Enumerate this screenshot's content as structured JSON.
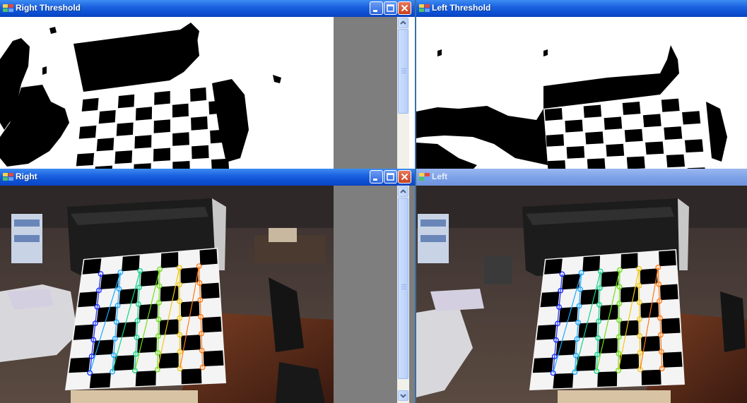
{
  "windows": {
    "right_threshold": {
      "title": "Right Threshold",
      "active": true
    },
    "left_threshold": {
      "title": "Left Threshold",
      "active": true
    },
    "right": {
      "title": "Right",
      "active": true
    },
    "left": {
      "title": "Left",
      "active": false
    }
  },
  "colors": {
    "titlebar_active": "#0c4fd2",
    "titlebar_inactive": "#7ea2e8",
    "close_button": "#c8401c",
    "image_padding": "#7e7e7e"
  },
  "icons": {
    "app": "opencv-window-icon",
    "minimize": "minimize-icon",
    "maximize": "maximize-icon",
    "close": "close-icon",
    "scroll_up": "scroll-up-arrow-icon",
    "scroll_down": "scroll-down-arrow-icon"
  }
}
